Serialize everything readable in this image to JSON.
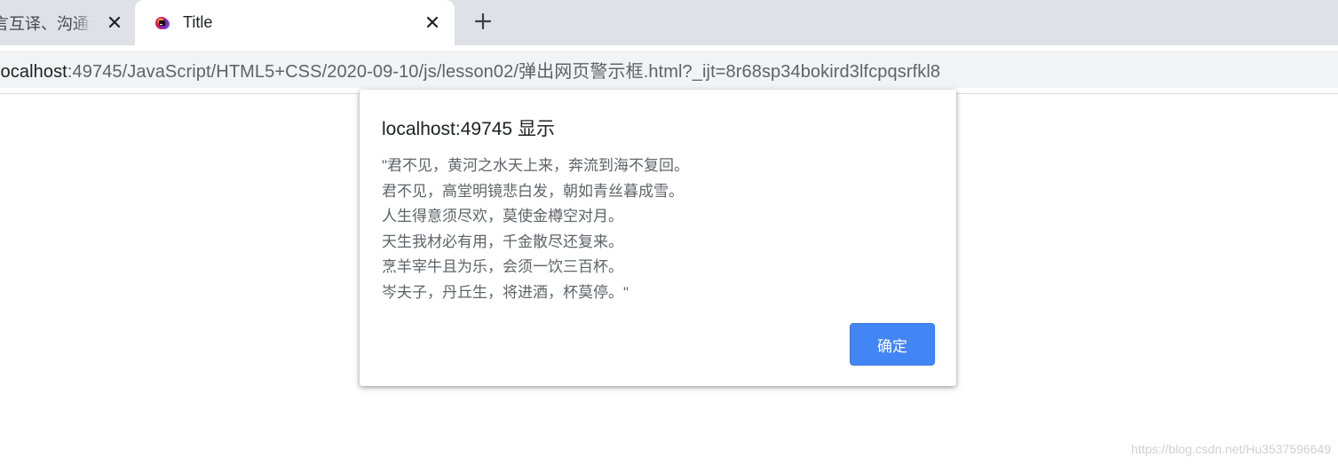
{
  "tabs": [
    {
      "title": "言互译、沟通全",
      "close_icon": "close-icon"
    },
    {
      "title": "Title",
      "favicon": "app-favicon",
      "close_icon": "close-icon",
      "active": true
    }
  ],
  "new_tab_icon": "plus-icon",
  "address_bar": {
    "host": "localhost",
    "path": ":49745/JavaScript/HTML5+CSS/2020-09-10/js/lesson02/弹出网页警示框.html?_ijt=8r68sp34bokird3lfcpqsrfkl8"
  },
  "dialog": {
    "title": "localhost:49745 显示",
    "message_lines": [
      "\"君不见，黄河之水天上来，奔流到海不复回。",
      "君不见，高堂明镜悲白发，朝如青丝暮成雪。",
      "人生得意须尽欢，莫使金樽空对月。",
      "天生我材必有用，千金散尽还复来。",
      "烹羊宰牛且为乐，会须一饮三百杯。",
      "岑夫子，丹丘生，将进酒，杯莫停。\""
    ],
    "ok_label": "确定",
    "accent_color": "#4285f4"
  },
  "watermark": "https://blog.csdn.net/Hu3537596649"
}
